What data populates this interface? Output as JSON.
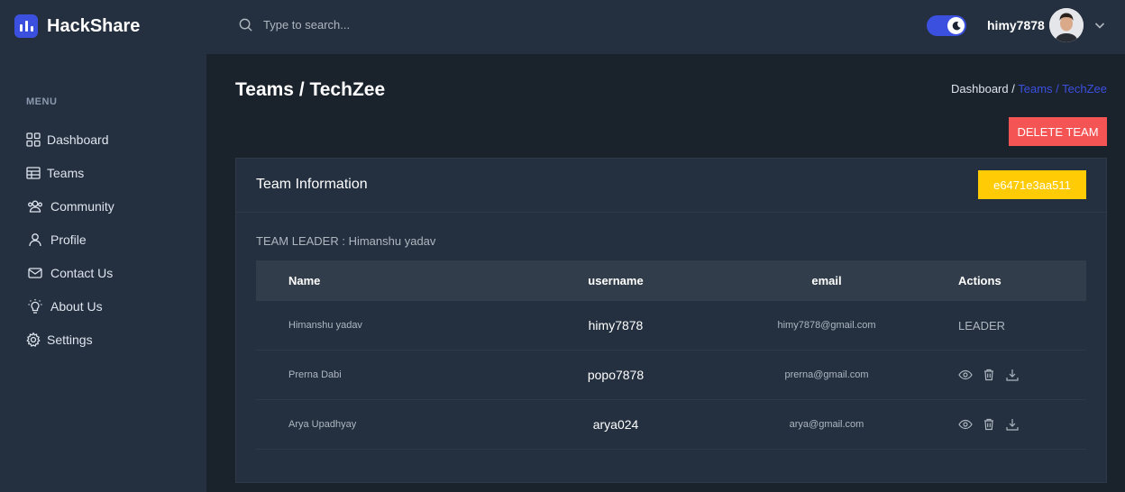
{
  "brand": {
    "name": "HackShare"
  },
  "search": {
    "placeholder": "Type to search..."
  },
  "user": {
    "name": "himy7878"
  },
  "menu": {
    "title": "MENU",
    "items": [
      {
        "label": "Dashboard",
        "icon": "grid-icon"
      },
      {
        "label": "Teams",
        "icon": "table-icon"
      },
      {
        "label": "Community",
        "icon": "users-icon"
      },
      {
        "label": "Profile",
        "icon": "user-icon"
      },
      {
        "label": "Contact Us",
        "icon": "mail-icon"
      },
      {
        "label": "About Us",
        "icon": "bulb-icon"
      },
      {
        "label": "Settings",
        "icon": "gear-icon"
      }
    ]
  },
  "page": {
    "title": "Teams / TechZee",
    "breadcrumb": {
      "root": "Dashboard /",
      "current": "Teams / TechZee"
    },
    "delete_label": "DELETE TEAM"
  },
  "team": {
    "card_title": "Team Information",
    "code": "e6471e3aa511",
    "leader_text": "TEAM LEADER : Himanshu yadav",
    "columns": [
      "Name",
      "username",
      "email",
      "Actions"
    ],
    "members": [
      {
        "name": "Himanshu yadav",
        "username": "himy7878",
        "email": "himy7878@gmail.com",
        "action": "LEADER"
      },
      {
        "name": "Prerna Dabi",
        "username": "popo7878",
        "email": "prerna@gmail.com",
        "action": ""
      },
      {
        "name": "Arya Upadhyay",
        "username": "arya024",
        "email": "arya@gmail.com",
        "action": ""
      }
    ]
  },
  "colors": {
    "accent": "#3c50e0",
    "danger": "#f55454",
    "warning": "#ffcb05",
    "panel": "#24303f",
    "background": "#1a222c"
  }
}
